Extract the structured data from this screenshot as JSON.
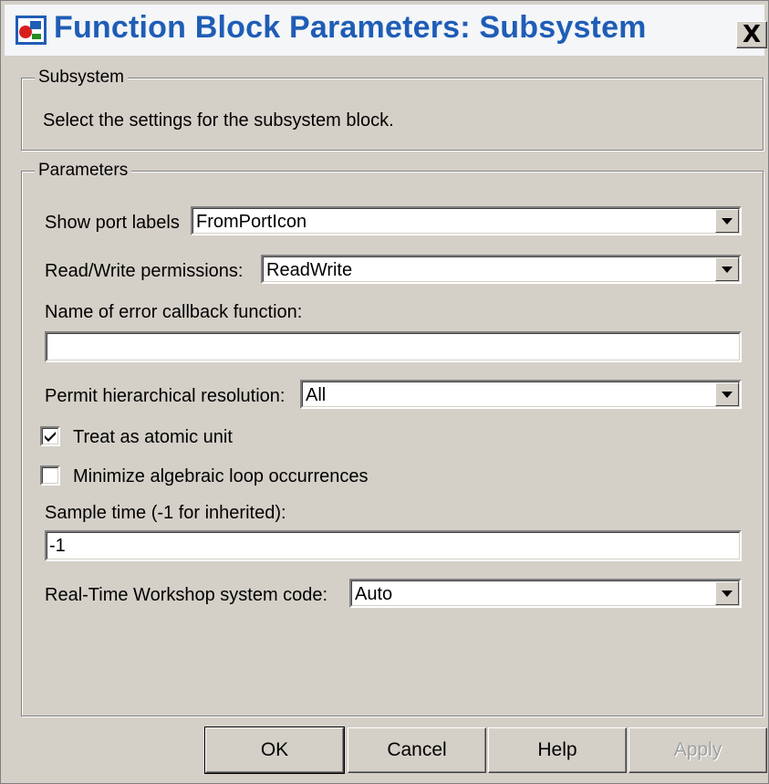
{
  "window": {
    "title": "Function Block Parameters: Subsystem",
    "close_label": "X"
  },
  "subsystem_group": {
    "legend": "Subsystem",
    "description": "Select the settings for the subsystem block."
  },
  "parameters_group": {
    "legend": "Parameters",
    "show_port_labels": {
      "label": "Show port labels",
      "value": "FromPortIcon"
    },
    "read_write": {
      "label": "Read/Write permissions:",
      "value": "ReadWrite"
    },
    "error_callback": {
      "label": "Name of error callback function:",
      "value": ""
    },
    "hierarchical_resolution": {
      "label": "Permit hierarchical resolution:",
      "value": "All"
    },
    "atomic_unit": {
      "label": "Treat as atomic unit",
      "checked": true
    },
    "minimize_loop": {
      "label": "Minimize algebraic loop occurrences",
      "checked": false
    },
    "sample_time": {
      "label": "Sample time (-1 for inherited):",
      "value": "-1"
    },
    "rtw_code": {
      "label": "Real-Time Workshop system code:",
      "value": "Auto"
    }
  },
  "buttons": {
    "ok": "OK",
    "cancel": "Cancel",
    "help": "Help",
    "apply": "Apply"
  }
}
